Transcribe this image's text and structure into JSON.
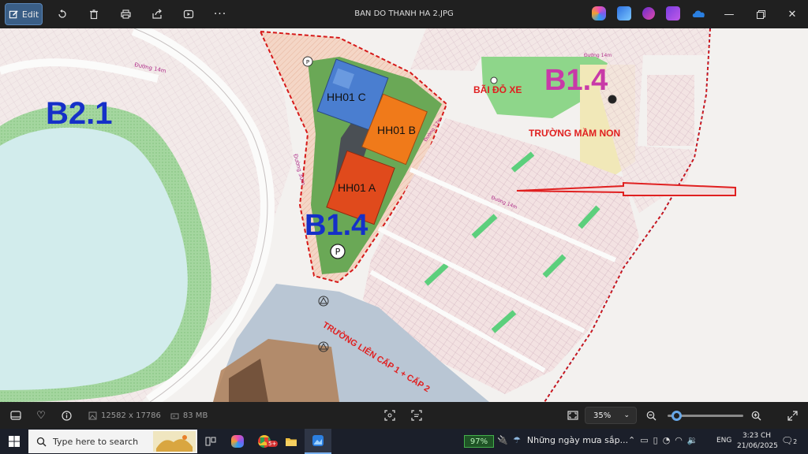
{
  "window": {
    "title": "BAN DO THANH HA 2.JPG"
  },
  "toolbar": {
    "edit_label": "Edit",
    "icons": [
      "edit-icon",
      "rotate-icon",
      "delete-icon",
      "print-icon",
      "share-icon",
      "slideshow-icon",
      "more-icon"
    ],
    "app_icons": [
      "copilot-icon",
      "photos-editor-icon",
      "clipchamp-icon",
      "video-editor-icon",
      "onedrive-icon"
    ],
    "window_controls": [
      "minimize-icon",
      "restore-icon",
      "close-icon"
    ]
  },
  "map": {
    "labels": {
      "zone_b21": "B2.1",
      "zone_b14_blue": "B1.4",
      "zone_b14_magenta": "B1.4",
      "hh01c": "HH01 C",
      "hh01b": "HH01 B",
      "hh01a": "HH01 A",
      "parking": "BÃI ĐỖ XE",
      "kindergarten": "TRƯỜNG MẦM NON",
      "school": "TRƯỜNG LIÊN CẤP 1 + CẤP 2",
      "parking_symbol": "P",
      "road_14m": "Đường 14m",
      "road_30m": "Đường 30m",
      "road_17m": "Đường 17m"
    },
    "colors": {
      "water": "#d2ecec",
      "park": "#a9d8a3",
      "green_area": "#8ed68a",
      "kindergarten_area": "#f1e8b8",
      "plot_fill": "#f1dede",
      "road": "#f7f6f4",
      "blue_label": "#1530c8",
      "magenta_label": "#c83aa8",
      "red_label": "#e02020",
      "building_blue": "#4a7ed0",
      "building_orange": "#f07a1a",
      "building_red": "#e04a1c",
      "boundary": "#d61a1a"
    }
  },
  "statusbar": {
    "dimensions": "12582 x 17786",
    "file_size": "83 MB",
    "zoom": "35%",
    "zoom_fraction": 0.06,
    "icons": [
      "filmstrip-icon",
      "favorite-icon",
      "info-icon",
      "image-size-icon",
      "storage-icon",
      "zoom-fit-icon",
      "actual-size-icon",
      "zoom-out-icon",
      "zoom-in-icon",
      "fullscreen-icon"
    ]
  },
  "taskbar": {
    "search_placeholder": "Type here to search",
    "battery": "97%",
    "weather_text": "Những ngày mưa sắp...",
    "lang": "ENG",
    "time": "3:23 CH",
    "date": "21/06/2025",
    "notification_count": "2",
    "badge": "5+"
  }
}
